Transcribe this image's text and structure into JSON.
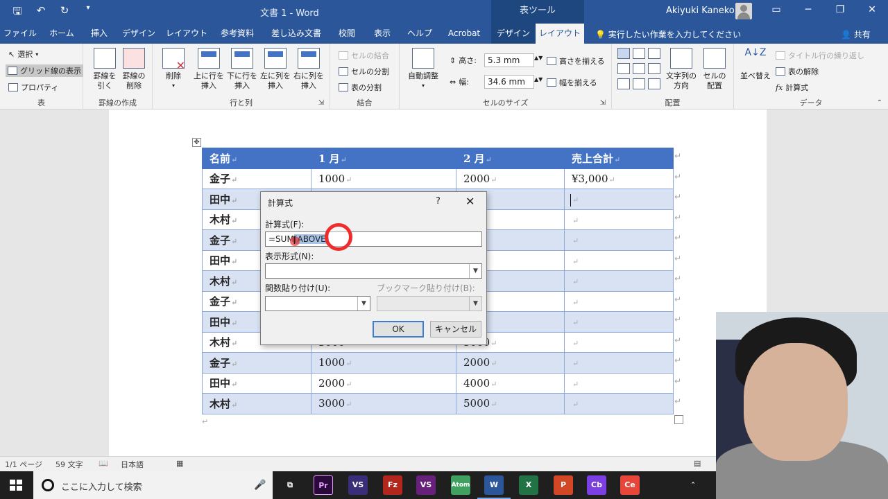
{
  "app": {
    "doc_title": "文書 1  -  Word",
    "context_tool": "表ツール",
    "user_name": "Akiyuki Kaneko",
    "tell_me": "実行したい作業を入力してください",
    "share": "共有"
  },
  "tabs": [
    {
      "label": "ファイル"
    },
    {
      "label": "ホーム"
    },
    {
      "label": "挿入"
    },
    {
      "label": "デザイン"
    },
    {
      "label": "レイアウト"
    },
    {
      "label": "参考資料"
    },
    {
      "label": "差し込み文書"
    },
    {
      "label": "校閲"
    },
    {
      "label": "表示"
    },
    {
      "label": "ヘルプ"
    },
    {
      "label": "Acrobat"
    },
    {
      "label": "デザイン"
    },
    {
      "label": "レイアウト"
    }
  ],
  "ribbon": {
    "table": {
      "label": "表",
      "select": "選択",
      "gridlines": "グリッド線の表示",
      "properties": "プロパティ"
    },
    "draw": {
      "label": "罫線の作成",
      "draw_line": "罫線を\n引く",
      "erase_line": "罫線の\n削除"
    },
    "rows": {
      "label": "行と列",
      "delete": "削除",
      "insert_above": "上に行を\n挿入",
      "insert_below": "下に行を\n挿入",
      "insert_left": "左に列を\n挿入",
      "insert_right": "右に列を\n挿入"
    },
    "merge": {
      "label": "結合",
      "merge_cells": "セルの結合",
      "split_cells": "セルの分割",
      "split_table": "表の分割"
    },
    "size": {
      "label": "セルのサイズ",
      "autofit": "自動調整",
      "height_label": "高さ:",
      "height_value": "5.3 mm",
      "width_label": "幅:",
      "width_value": "34.6 mm",
      "distribute_rows": "高さを揃える",
      "distribute_cols": "幅を揃える"
    },
    "align": {
      "label": "配置",
      "text_direction": "文字列の\n方向",
      "cell_margins": "セルの\n配置"
    },
    "data": {
      "label": "データ",
      "sort": "並べ替え",
      "repeat_header": "タイトル行の繰り返し",
      "convert": "表の解除",
      "formula": "計算式"
    }
  },
  "table": {
    "headers": [
      "名前",
      "1 月",
      "2 月",
      "売上合計"
    ],
    "rows": [
      [
        "金子",
        "1000",
        "2000",
        "¥3,000"
      ],
      [
        "田中",
        "",
        "",
        ""
      ],
      [
        "木村",
        "",
        "",
        ""
      ],
      [
        "金子",
        "",
        "",
        ""
      ],
      [
        "田中",
        "",
        "",
        ""
      ],
      [
        "木村",
        "",
        "",
        ""
      ],
      [
        "金子",
        "",
        "",
        ""
      ],
      [
        "田中",
        "",
        "",
        ""
      ],
      [
        "木村",
        "3000",
        "5000",
        ""
      ],
      [
        "金子",
        "1000",
        "2000",
        ""
      ],
      [
        "田中",
        "2000",
        "4000",
        ""
      ],
      [
        "木村",
        "3000",
        "5000",
        ""
      ]
    ]
  },
  "dialog": {
    "title": "計算式",
    "help": "?",
    "formula_label": "計算式(F):",
    "formula_prefix": "=SUM",
    "formula_selected": "(ABOVE)",
    "format_label": "表示形式(N):",
    "paste_function_label": "関数貼り付け(U):",
    "bookmark_label": "ブックマーク貼り付け(B):",
    "ok": "OK",
    "cancel": "キャンセル"
  },
  "status": {
    "page": "1/1 ページ",
    "words": "59 文字",
    "language": "日本語"
  },
  "taskbar": {
    "search_placeholder": "ここに入力して検索",
    "apps": [
      "Pr",
      "VS",
      "Fz",
      "VS",
      "Atom",
      "W",
      "X",
      "P",
      "Cb",
      "Ce"
    ]
  },
  "colors": {
    "word_blue": "#2b579a",
    "table_header": "#4472c4",
    "table_band": "#d9e2f3",
    "annotation_red": "#ef2b2b"
  }
}
